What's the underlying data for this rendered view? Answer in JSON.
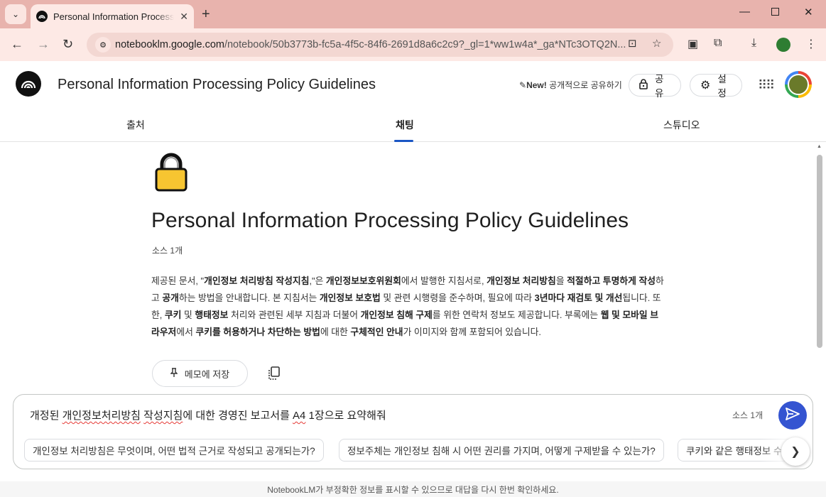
{
  "browser": {
    "tab_title": "Personal Information Processing Policy Guidelines",
    "url_host": "notebooklm.google.com",
    "url_path": "/notebook/50b3773b-fc5a-4f5c-84f6-2691d8a6c2c9?_gl=1*ww1w4a*_ga*NTc3OTQ2N..."
  },
  "header": {
    "title": "Personal Information Processing Policy Guidelines",
    "new_badge": "New!",
    "public_share_label": "공개적으로 공유하기",
    "share_label": "공유",
    "settings_label": "설정"
  },
  "tabs": {
    "sources": "출처",
    "chat": "채팅",
    "studio": "스튜디오"
  },
  "notebook": {
    "title": "Personal Information Processing Policy Guidelines",
    "source_count": "소스 1개",
    "save_note_label": "메모에 저장",
    "summary": [
      {
        "t": "제공된 문서, \"",
        "b": false
      },
      {
        "t": "개인정보 처리방침 작성지침",
        "b": true
      },
      {
        "t": ",\"은 ",
        "b": false
      },
      {
        "t": "개인정보보호위원회",
        "b": true
      },
      {
        "t": "에서 발행한 지침서로, ",
        "b": false
      },
      {
        "t": "개인정보 처리방침",
        "b": true
      },
      {
        "t": "을 ",
        "b": false
      },
      {
        "t": "적절하고 투명하게 작성",
        "b": true
      },
      {
        "t": "하고 ",
        "b": false
      },
      {
        "t": "공개",
        "b": true
      },
      {
        "t": "하는 방법을 안내합니다. 본 지침서는 ",
        "b": false
      },
      {
        "t": "개인정보 보호법",
        "b": true
      },
      {
        "t": " 및 관련 시행령을 준수하며, 필요에 따라 ",
        "b": false
      },
      {
        "t": "3년마다 재검토 및 개선",
        "b": true
      },
      {
        "t": "됩니다. 또한, ",
        "b": false
      },
      {
        "t": "쿠키",
        "b": true
      },
      {
        "t": " 및 ",
        "b": false
      },
      {
        "t": "행태정보",
        "b": true
      },
      {
        "t": " 처리와 관련된 세부 지침과 더불어 ",
        "b": false
      },
      {
        "t": "개인정보 침해 구제",
        "b": true
      },
      {
        "t": "를 위한 연락처 정보도 제공합니다. 부록에는 ",
        "b": false
      },
      {
        "t": "웹 및 모바일 브라우저",
        "b": true
      },
      {
        "t": "에서 ",
        "b": false
      },
      {
        "t": "쿠키를 허용하거나 차단하는 방법",
        "b": true
      },
      {
        "t": "에 대한 ",
        "b": false
      },
      {
        "t": "구체적인 안내",
        "b": true
      },
      {
        "t": "가 이미지와 함께 포함되어 있습니다.",
        "b": false
      }
    ]
  },
  "chat": {
    "input_parts": [
      {
        "t": "개정된 ",
        "sq": false
      },
      {
        "t": "개인정보처리방침",
        "sq": true
      },
      {
        "t": " ",
        "sq": false
      },
      {
        "t": "작성지침",
        "sq": true
      },
      {
        "t": "에 대한 경영진 보고서를 ",
        "sq": false
      },
      {
        "t": "A4",
        "sq": true
      },
      {
        "t": " 1장으로 요약해줘",
        "sq": false
      }
    ],
    "source_count": "소스 1개",
    "suggestions": [
      "개인정보 처리방침은 무엇이며, 어떤 법적 근거로 작성되고 공개되는가?",
      "정보주체는 개인정보 침해 시 어떤 권리를 가지며, 어떻게 구제받을 수 있는가?",
      "쿠키와 같은 행태정보 수"
    ]
  },
  "footer": {
    "disclaimer": "NotebookLM가 부정확한 정보를 표시할 수 있으므로 대답을 다시 한번 확인하세요."
  }
}
